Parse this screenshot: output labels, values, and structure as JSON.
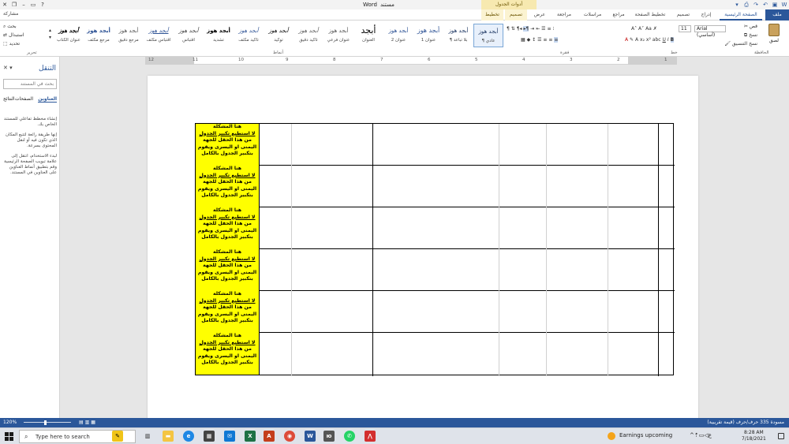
{
  "titlebar": {
    "doc_name": "مستند",
    "app_name": "Word",
    "context_group": "أدوات الجدول",
    "share_label": "مشاركة",
    "search_icon": "lightbulb-icon"
  },
  "tabs": [
    {
      "label": "ملف",
      "kind": "file"
    },
    {
      "label": "الصفحة الرئيسية",
      "kind": "active"
    },
    {
      "label": "إدراج",
      "kind": "normal"
    },
    {
      "label": "تصميم",
      "kind": "normal"
    },
    {
      "label": "تخطيط الصفحة",
      "kind": "normal"
    },
    {
      "label": "مراجع",
      "kind": "normal"
    },
    {
      "label": "مراسلات",
      "kind": "normal"
    },
    {
      "label": "مراجعة",
      "kind": "normal"
    },
    {
      "label": "عرض",
      "kind": "normal"
    },
    {
      "label": "تصميم",
      "kind": "ctx"
    },
    {
      "label": "تخطيط",
      "kind": "ctx"
    }
  ],
  "ribbon": {
    "clipboard_label": "الحافظة",
    "paste_label": "لصق",
    "cut_label": "قص",
    "copy_label": "نسخ",
    "format_painter_label": "نسخ التنسيق",
    "font_label": "خط",
    "paragraph_label": "فقرة",
    "styles_label": "أنماط",
    "editing_label": "تحرير",
    "find_label": "بحث",
    "replace_label": "استبدال",
    "select_label": "تحديد",
    "font_name": "Arial (أساسي)",
    "font_size": "11",
    "styles": [
      {
        "sample": "أبجد هوز",
        "name": "¶ عادي",
        "selected": true
      },
      {
        "sample": "أبجد هوز",
        "name": "¶ بلا تباعد",
        "selected": false
      },
      {
        "sample": "أبجد هوز",
        "name": "عنوان 1",
        "selected": false
      },
      {
        "sample": "أبجد هوز",
        "name": "عنوان 2",
        "selected": false
      },
      {
        "sample": "أبجد",
        "name": "العنوان",
        "selected": false
      },
      {
        "sample": "أبجد هوز",
        "name": "عنوان فرعي",
        "selected": false
      },
      {
        "sample": "أبجد هوز",
        "name": "تأكيد دقيق",
        "selected": false
      },
      {
        "sample": "أبجد هوز",
        "name": "توكيد",
        "selected": false
      },
      {
        "sample": "أبجد هوز",
        "name": "تأكيد مكثف",
        "selected": false
      },
      {
        "sample": "أبجد هوز",
        "name": "تشديد",
        "selected": false
      },
      {
        "sample": "أبجد هوز",
        "name": "اقتباس",
        "selected": false
      },
      {
        "sample": "أبجد هوز",
        "name": "اقتباس مكثف",
        "selected": false
      },
      {
        "sample": "أبجد هوز",
        "name": "مرجع دقيق",
        "selected": false
      },
      {
        "sample": "أبجد هوز",
        "name": "مرجع مكثف",
        "selected": false
      },
      {
        "sample": "أبجد هوز",
        "name": "عنوان الكتاب",
        "selected": false
      }
    ]
  },
  "ruler": {
    "numbers": [
      "12",
      "11",
      "10",
      "9",
      "8",
      "7",
      "6",
      "5",
      "4",
      "3",
      "2",
      "1"
    ]
  },
  "nav": {
    "title": "التنقل",
    "search_placeholder": "بحث في المستند",
    "tab_headings": "العناوين",
    "tab_pages": "الصفحات",
    "tab_results": "النتائج",
    "body_1": "إنشاء مخطط تفاعلي للمستند الخاص بك.",
    "body_2": "إنها طريقة رائعة لتتبع المكان الذي تكون فيه أو لنقل المحتوى بسرعة.",
    "body_3": "لبدء الاستخدام، انتقل إلى علامة تبويب الصفحة الرئيسية وقم بتطبيق أنماط العناوين على العناوين في المستند."
  },
  "table": {
    "row_count": 6,
    "cell_lines": [
      "هنا المشكلة",
      "لا استطيع تكبير الجدول",
      "من هذا الحقل للجهة",
      "اليمنى او اليسرى ويقوم",
      "بتكبير الجدول بالكامل"
    ]
  },
  "statusbar": {
    "zoom": "120%",
    "page_info": "مسودة 335 حرف/حرف (قيمة تقريبية)"
  },
  "taskbar": {
    "search_placeholder": "Type here to search",
    "weather": "Earnings upcoming",
    "time": "8:28 AM",
    "date": "7/18/2021"
  }
}
